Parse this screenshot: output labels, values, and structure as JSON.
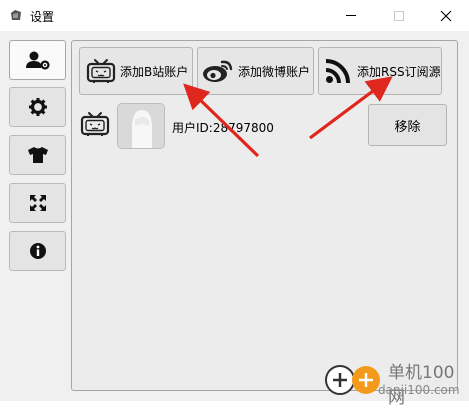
{
  "window": {
    "title": "设置"
  },
  "sidebar": {
    "items": [
      {
        "name": "account",
        "icon": "user-gear-icon"
      },
      {
        "name": "settings",
        "icon": "gear-icon"
      },
      {
        "name": "theme",
        "icon": "tshirt-icon"
      },
      {
        "name": "fullscreen",
        "icon": "expand-icon"
      },
      {
        "name": "about",
        "icon": "info-icon"
      }
    ]
  },
  "toolbar": {
    "add_bilibili_label": "添加B站账户",
    "add_weibo_label": "添加微博账户",
    "add_rss_label": "添加RSS订阅源"
  },
  "account": {
    "user_id_label": "用户ID:28797800",
    "remove_label": "移除"
  },
  "watermark": {
    "title": "单机100网",
    "url": "danji100.com"
  },
  "colors": {
    "arrow": "#e0271d",
    "weibo_red": "#e6162d"
  }
}
